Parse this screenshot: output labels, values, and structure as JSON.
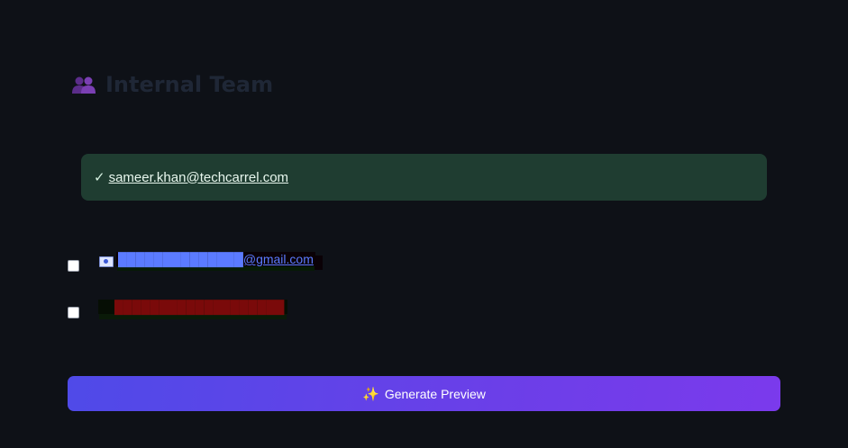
{
  "section": {
    "title": "Internal Team",
    "icon": "users-icon"
  },
  "success": {
    "check": "✓",
    "email": "sameer.khan@techcarrel.com"
  },
  "members": [
    {
      "email": "██████████████@gmail.com",
      "flag_icon": "blue-badge-icon",
      "checked": false
    },
    {
      "email": "███████████████████",
      "flag_icon": "green-badge-icon",
      "checked": false
    }
  ],
  "generate": {
    "icon": "sparkle-icon",
    "label": "Generate Preview"
  },
  "colors": {
    "background": "#0e1117",
    "success_bg": "#1f3d31",
    "button_start": "#4f4ae8",
    "button_end": "#7b3aec"
  }
}
